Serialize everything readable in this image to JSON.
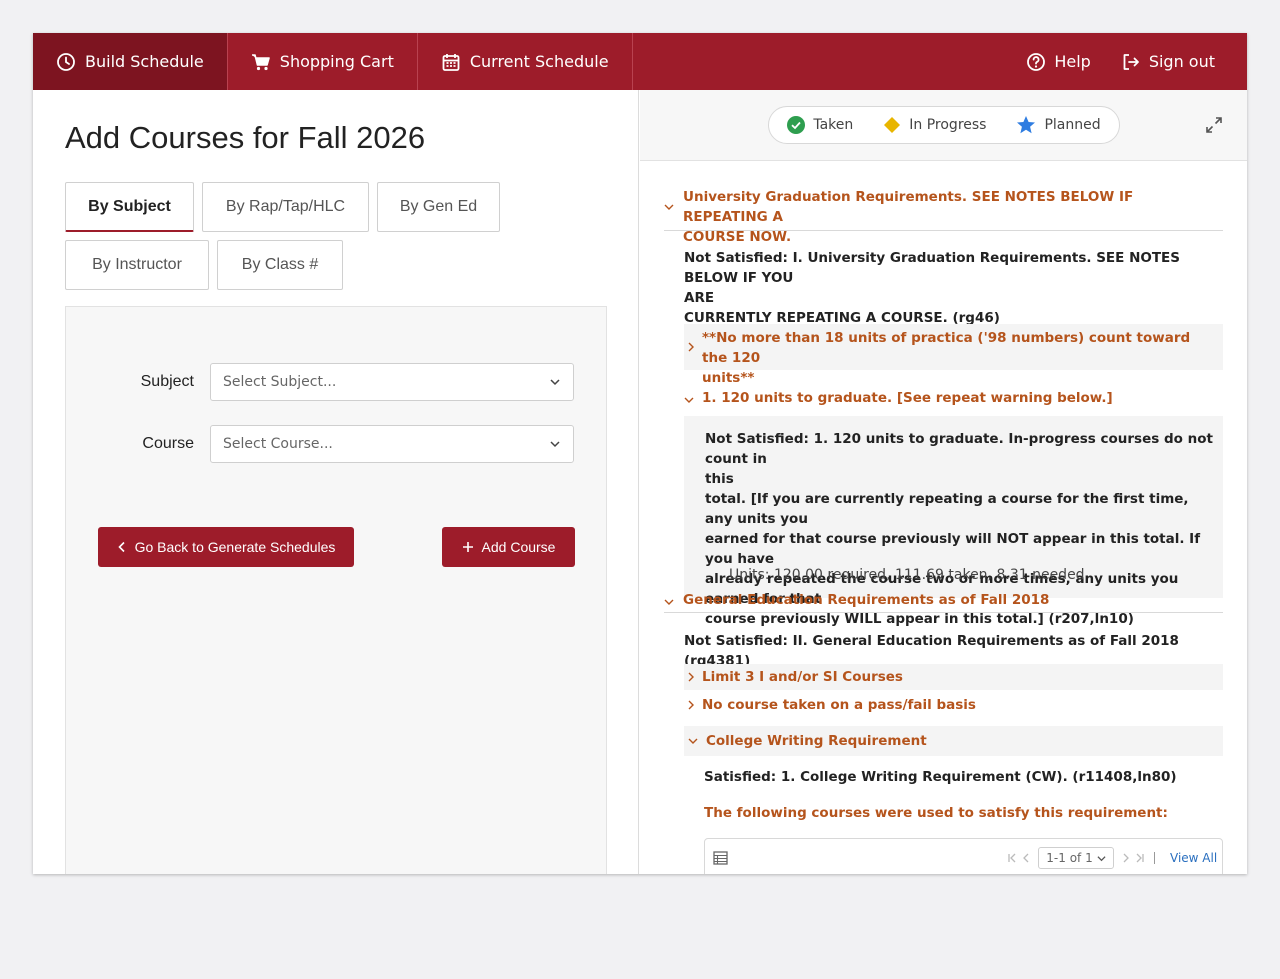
{
  "nav": {
    "tabs": [
      {
        "label": "Build Schedule",
        "icon": "clock-icon"
      },
      {
        "label": "Shopping Cart",
        "icon": "cart-icon"
      },
      {
        "label": "Current Schedule",
        "icon": "calendar-icon"
      }
    ],
    "help": "Help",
    "signout": "Sign out"
  },
  "left": {
    "title": "Add Courses for Fall 2026",
    "filter_tabs": [
      "By Subject",
      "By Rap/Tap/HLC",
      "By Gen Ed",
      "By Instructor",
      "By Class #"
    ],
    "subject_label": "Subject",
    "subject_placeholder": "Select Subject...",
    "course_label": "Course",
    "course_placeholder": "Select Course...",
    "back_button": "Go Back to Generate Schedules",
    "add_button": "Add Course"
  },
  "legend": {
    "taken": "Taken",
    "in_progress": "In Progress",
    "planned": "Planned"
  },
  "requirements": {
    "univ_head_1": "University Graduation Requirements. SEE NOTES BELOW IF REPEATING A",
    "univ_head_2": "COURSE NOW.",
    "univ_status_1": "Not Satisfied: I. University Graduation Requirements. SEE NOTES BELOW IF YOU",
    "univ_status_2": "ARE",
    "univ_status_3": "CURRENTLY REPEATING A COURSE. (rg46)",
    "practica_1": "**No more than 18 units of practica ('98 numbers) count toward the 120",
    "practica_2": "units**",
    "units_head": "1. 120 units to graduate. [See repeat warning below.]",
    "units_status": [
      "Not Satisfied: 1. 120 units to graduate. In-progress courses do not count in",
      "this",
      "total. [If you are currently repeating a course for the first time, any units you",
      "earned for that course previously will NOT appear in this total. If you have",
      "already repeated the course two or more times, any units you earned for that",
      "course previously WILL appear in this total.] (r207,ln10)"
    ],
    "units_summary": "Units: 120.00 required, 111.69 taken, 8.31 needed",
    "gened_head": "General Education Requirements as of Fall 2018",
    "gened_status": "Not Satisfied: II. General Education Requirements as of Fall 2018 (rg4381)",
    "limit3": "Limit 3 I and/or SI Courses",
    "passfail": "No course taken on a pass/fail basis",
    "cw_head": "College Writing Requirement",
    "cw_status": "Satisfied: 1. College Writing Requirement (CW). (r11408,ln80)",
    "cw_courses": "The following courses were used to satisfy this requirement:"
  },
  "table": {
    "pager": "1-1 of 1",
    "view_all": "View All"
  },
  "colors": {
    "brand": "#9d1c2a",
    "brand_dark": "#7d1420",
    "req_orange": "#b5541c",
    "taken_green": "#2e9e4f",
    "in_progress_yellow": "#e8b500",
    "planned_blue": "#2f7de1"
  }
}
